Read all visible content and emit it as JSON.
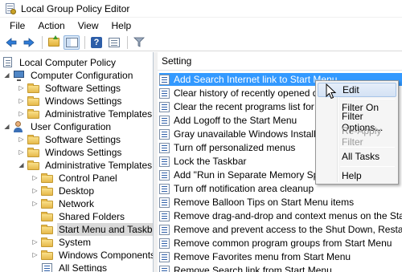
{
  "window": {
    "title": "Local Group Policy Editor",
    "icon": "group-policy-icon"
  },
  "menubar": {
    "items": [
      "File",
      "Action",
      "View",
      "Help"
    ]
  },
  "toolbar": {
    "buttons": [
      "back-icon",
      "forward-icon",
      "up-folder-icon",
      "show-hide-tree-icon",
      "help-icon",
      "properties-icon",
      "filter-icon"
    ]
  },
  "tree": {
    "items": [
      {
        "label": "Local Computer Policy",
        "icon": "policy-icon"
      },
      {
        "label": "Computer Configuration",
        "icon": "computer-icon"
      },
      {
        "label": "Software Settings",
        "icon": "folder-icon"
      },
      {
        "label": "Windows Settings",
        "icon": "folder-icon"
      },
      {
        "label": "Administrative Templates",
        "icon": "folder-icon"
      },
      {
        "label": "User Configuration",
        "icon": "user-icon"
      },
      {
        "label": "Software Settings",
        "icon": "folder-icon"
      },
      {
        "label": "Windows Settings",
        "icon": "folder-icon"
      },
      {
        "label": "Administrative Templates",
        "icon": "folder-icon"
      },
      {
        "label": "Control Panel",
        "icon": "folder-icon"
      },
      {
        "label": "Desktop",
        "icon": "folder-icon"
      },
      {
        "label": "Network",
        "icon": "folder-icon"
      },
      {
        "label": "Shared Folders",
        "icon": "folder-icon"
      },
      {
        "label": "Start Menu and Taskbar",
        "icon": "folder-icon",
        "selected": true
      },
      {
        "label": "System",
        "icon": "folder-icon"
      },
      {
        "label": "Windows Components",
        "icon": "folder-icon"
      },
      {
        "label": "All Settings",
        "icon": "all-settings-icon"
      }
    ]
  },
  "list": {
    "column_header": "Setting",
    "rows": [
      "Add Search Internet link to Start Menu",
      "Clear history of recently opened docum",
      "Clear the recent programs list for new u",
      "Add Logoff to the Start Menu",
      "Gray unavailable Windows Installer pro",
      "Turn off personalized menus",
      "Lock the Taskbar",
      "Add \"Run in Separate Memory Space\" c",
      "Turn off notification area cleanup",
      "Remove Balloon Tips on Start Menu items",
      "Remove drag-and-drop and context menus on the Start Me...",
      "Remove and prevent access to the Shut Down, Restart, Sleep...",
      "Remove common program groups from Start Menu",
      "Remove Favorites menu from Start Menu",
      "Remove Search link from Start Menu"
    ]
  },
  "context_menu": {
    "items": [
      "Edit",
      "Filter On",
      "Filter Options...",
      "Re-Apply Filter",
      "All Tasks",
      "Help"
    ]
  }
}
